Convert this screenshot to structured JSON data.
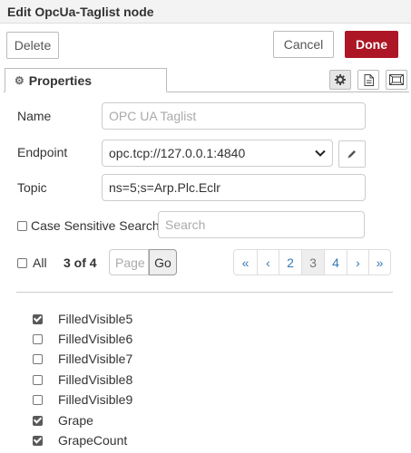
{
  "window": {
    "title": "Edit OpcUa-Taglist node"
  },
  "toolbar": {
    "delete_label": "Delete",
    "cancel_label": "Cancel",
    "done_label": "Done"
  },
  "tabs": {
    "properties_label": "Properties"
  },
  "form": {
    "name_label": "Name",
    "name_placeholder": "OPC UA Taglist",
    "endpoint_label": "Endpoint",
    "endpoint_value": "opc.tcp://127.0.0.1:4840",
    "topic_label": "Topic",
    "topic_value": "ns=5;s=Arp.Plc.Eclr",
    "case_sensitive_label": "Case Sensitive Search",
    "search_placeholder": "Search"
  },
  "paging": {
    "all_label": "All",
    "page_count": "3 of 4",
    "page_placeholder": "Page",
    "go_label": "Go",
    "pages": [
      "«",
      "‹",
      "2",
      "3",
      "4",
      "›",
      "»"
    ],
    "active_page": "3"
  },
  "tags": [
    {
      "name": "FilledVisible5",
      "checked": true
    },
    {
      "name": "FilledVisible6",
      "checked": false
    },
    {
      "name": "FilledVisible7",
      "checked": false
    },
    {
      "name": "FilledVisible8",
      "checked": false
    },
    {
      "name": "FilledVisible9",
      "checked": false
    },
    {
      "name": "Grape",
      "checked": true
    },
    {
      "name": "GrapeCount",
      "checked": true
    }
  ],
  "colors": {
    "primary": "#ad1625",
    "link": "#337ab7"
  }
}
